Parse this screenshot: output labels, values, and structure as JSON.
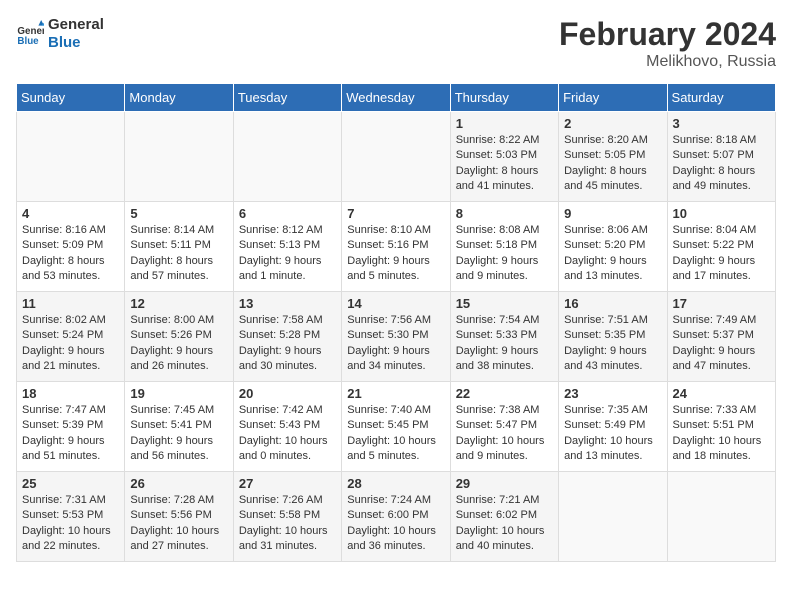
{
  "header": {
    "logo_line1": "General",
    "logo_line2": "Blue",
    "month_year": "February 2024",
    "location": "Melikhovo, Russia"
  },
  "days_of_week": [
    "Sunday",
    "Monday",
    "Tuesday",
    "Wednesday",
    "Thursday",
    "Friday",
    "Saturday"
  ],
  "weeks": [
    [
      {
        "day": "",
        "info": ""
      },
      {
        "day": "",
        "info": ""
      },
      {
        "day": "",
        "info": ""
      },
      {
        "day": "",
        "info": ""
      },
      {
        "day": "1",
        "info": "Sunrise: 8:22 AM\nSunset: 5:03 PM\nDaylight: 8 hours\nand 41 minutes."
      },
      {
        "day": "2",
        "info": "Sunrise: 8:20 AM\nSunset: 5:05 PM\nDaylight: 8 hours\nand 45 minutes."
      },
      {
        "day": "3",
        "info": "Sunrise: 8:18 AM\nSunset: 5:07 PM\nDaylight: 8 hours\nand 49 minutes."
      }
    ],
    [
      {
        "day": "4",
        "info": "Sunrise: 8:16 AM\nSunset: 5:09 PM\nDaylight: 8 hours\nand 53 minutes."
      },
      {
        "day": "5",
        "info": "Sunrise: 8:14 AM\nSunset: 5:11 PM\nDaylight: 8 hours\nand 57 minutes."
      },
      {
        "day": "6",
        "info": "Sunrise: 8:12 AM\nSunset: 5:13 PM\nDaylight: 9 hours\nand 1 minute."
      },
      {
        "day": "7",
        "info": "Sunrise: 8:10 AM\nSunset: 5:16 PM\nDaylight: 9 hours\nand 5 minutes."
      },
      {
        "day": "8",
        "info": "Sunrise: 8:08 AM\nSunset: 5:18 PM\nDaylight: 9 hours\nand 9 minutes."
      },
      {
        "day": "9",
        "info": "Sunrise: 8:06 AM\nSunset: 5:20 PM\nDaylight: 9 hours\nand 13 minutes."
      },
      {
        "day": "10",
        "info": "Sunrise: 8:04 AM\nSunset: 5:22 PM\nDaylight: 9 hours\nand 17 minutes."
      }
    ],
    [
      {
        "day": "11",
        "info": "Sunrise: 8:02 AM\nSunset: 5:24 PM\nDaylight: 9 hours\nand 21 minutes."
      },
      {
        "day": "12",
        "info": "Sunrise: 8:00 AM\nSunset: 5:26 PM\nDaylight: 9 hours\nand 26 minutes."
      },
      {
        "day": "13",
        "info": "Sunrise: 7:58 AM\nSunset: 5:28 PM\nDaylight: 9 hours\nand 30 minutes."
      },
      {
        "day": "14",
        "info": "Sunrise: 7:56 AM\nSunset: 5:30 PM\nDaylight: 9 hours\nand 34 minutes."
      },
      {
        "day": "15",
        "info": "Sunrise: 7:54 AM\nSunset: 5:33 PM\nDaylight: 9 hours\nand 38 minutes."
      },
      {
        "day": "16",
        "info": "Sunrise: 7:51 AM\nSunset: 5:35 PM\nDaylight: 9 hours\nand 43 minutes."
      },
      {
        "day": "17",
        "info": "Sunrise: 7:49 AM\nSunset: 5:37 PM\nDaylight: 9 hours\nand 47 minutes."
      }
    ],
    [
      {
        "day": "18",
        "info": "Sunrise: 7:47 AM\nSunset: 5:39 PM\nDaylight: 9 hours\nand 51 minutes."
      },
      {
        "day": "19",
        "info": "Sunrise: 7:45 AM\nSunset: 5:41 PM\nDaylight: 9 hours\nand 56 minutes."
      },
      {
        "day": "20",
        "info": "Sunrise: 7:42 AM\nSunset: 5:43 PM\nDaylight: 10 hours\nand 0 minutes."
      },
      {
        "day": "21",
        "info": "Sunrise: 7:40 AM\nSunset: 5:45 PM\nDaylight: 10 hours\nand 5 minutes."
      },
      {
        "day": "22",
        "info": "Sunrise: 7:38 AM\nSunset: 5:47 PM\nDaylight: 10 hours\nand 9 minutes."
      },
      {
        "day": "23",
        "info": "Sunrise: 7:35 AM\nSunset: 5:49 PM\nDaylight: 10 hours\nand 13 minutes."
      },
      {
        "day": "24",
        "info": "Sunrise: 7:33 AM\nSunset: 5:51 PM\nDaylight: 10 hours\nand 18 minutes."
      }
    ],
    [
      {
        "day": "25",
        "info": "Sunrise: 7:31 AM\nSunset: 5:53 PM\nDaylight: 10 hours\nand 22 minutes."
      },
      {
        "day": "26",
        "info": "Sunrise: 7:28 AM\nSunset: 5:56 PM\nDaylight: 10 hours\nand 27 minutes."
      },
      {
        "day": "27",
        "info": "Sunrise: 7:26 AM\nSunset: 5:58 PM\nDaylight: 10 hours\nand 31 minutes."
      },
      {
        "day": "28",
        "info": "Sunrise: 7:24 AM\nSunset: 6:00 PM\nDaylight: 10 hours\nand 36 minutes."
      },
      {
        "day": "29",
        "info": "Sunrise: 7:21 AM\nSunset: 6:02 PM\nDaylight: 10 hours\nand 40 minutes."
      },
      {
        "day": "",
        "info": ""
      },
      {
        "day": "",
        "info": ""
      }
    ]
  ]
}
